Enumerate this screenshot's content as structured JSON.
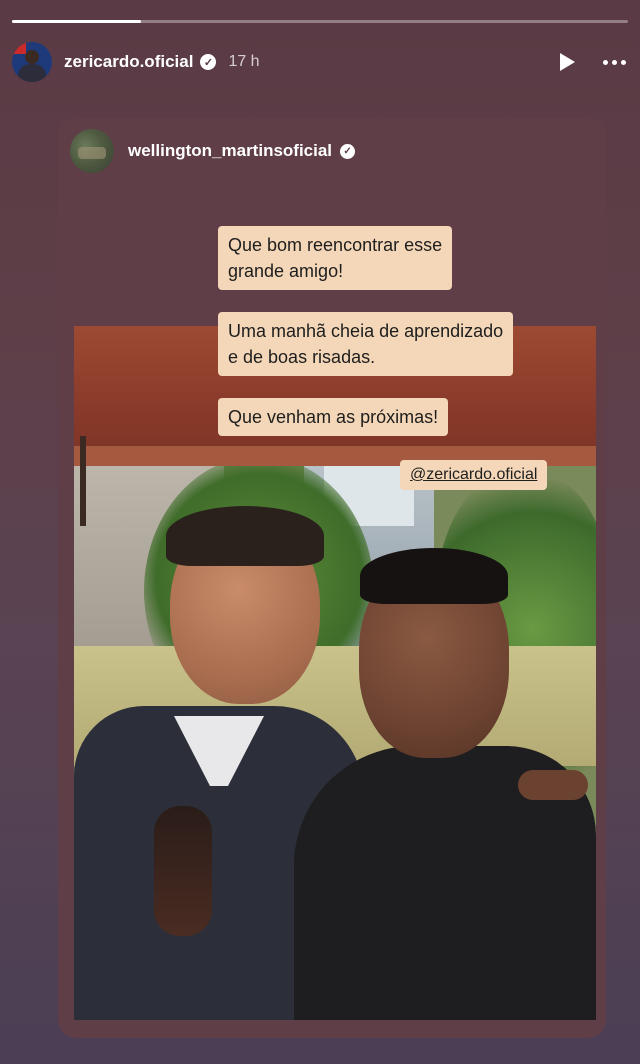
{
  "story": {
    "progress_fraction": 0.21
  },
  "header": {
    "avatar_icon": "user-avatar",
    "username": "zericardo.oficial",
    "time": "17 h",
    "play_icon": "play-icon",
    "more_icon": "more-options-icon"
  },
  "repost": {
    "username": "wellington_martinsoficial",
    "avatar_icon": "user-avatar"
  },
  "stickers": {
    "text1": "Que bom reencontrar esse\ngrande amigo!",
    "text2": "Uma manhã cheia de aprendizado\ne de boas risadas.",
    "text3": "Que venham as próximas!",
    "mention": "@zericardo.oficial"
  }
}
